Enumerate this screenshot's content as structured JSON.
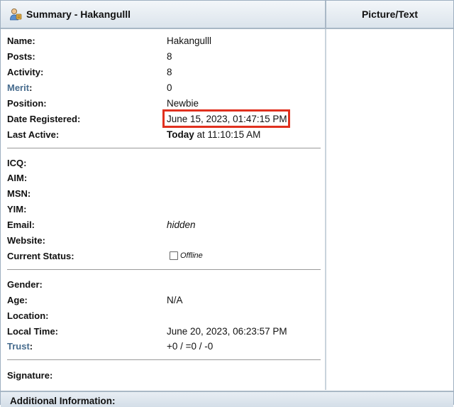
{
  "header": {
    "title": "Summary - Hakangulll",
    "picture_heading": "Picture/Text",
    "icon": "user-icon"
  },
  "summary": {
    "name": {
      "label": "Name:",
      "value": "Hakangulll"
    },
    "posts": {
      "label": "Posts:",
      "value": "8"
    },
    "activity": {
      "label": "Activity:",
      "value": "8"
    },
    "merit": {
      "label": "Merit",
      "colon": ":",
      "value": "0"
    },
    "position": {
      "label": "Position:",
      "value": "Newbie"
    },
    "date_registered": {
      "label": "Date Registered:",
      "value": "June 15, 2023, 01:47:15 PM"
    },
    "last_active": {
      "label": "Last Active:",
      "value_bold": "Today",
      "value_rest": " at 11:10:15 AM"
    }
  },
  "contact": {
    "icq": {
      "label": "ICQ:"
    },
    "aim": {
      "label": "AIM:"
    },
    "msn": {
      "label": "MSN:"
    },
    "yim": {
      "label": "YIM:"
    },
    "email": {
      "label": "Email:",
      "value": "hidden"
    },
    "website": {
      "label": "Website:"
    },
    "current_status": {
      "label": "Current Status:",
      "value": "Offline"
    }
  },
  "personal": {
    "gender": {
      "label": "Gender:"
    },
    "age": {
      "label": "Age:",
      "value": "N/A"
    },
    "location": {
      "label": "Location:"
    },
    "local_time": {
      "label": "Local Time:",
      "value": "June 20, 2023, 06:23:57 PM"
    },
    "trust": {
      "label": "Trust",
      "colon": ":",
      "value": "+0 / =0 / -0"
    }
  },
  "signature": {
    "label": "Signature:"
  },
  "footer": {
    "title": "Additional Information:"
  },
  "colors": {
    "link": "#476c8e",
    "highlight_border": "#e0301e",
    "header_bg": "#dbe4ec"
  }
}
